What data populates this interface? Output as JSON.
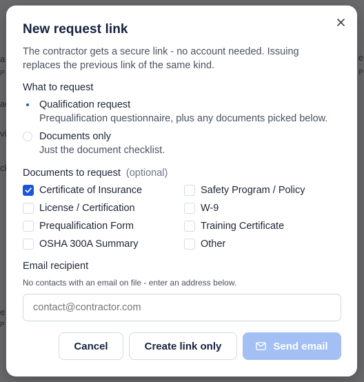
{
  "background": {
    "fragments": [
      "a",
      "P",
      "ac",
      "vi",
      "ck",
      "e",
      "P",
      "e",
      "P"
    ]
  },
  "modal": {
    "title": "New request link",
    "close_label": "×",
    "intro": "The contractor gets a secure link - no account needed. Issuing replaces the previous link of the same kind.",
    "what_to_request": {
      "label": "What to request",
      "options": [
        {
          "label": "Qualification request",
          "description": "Prequalification questionnaire, plus any documents picked below.",
          "selected": true
        },
        {
          "label": "Documents only",
          "description": "Just the document checklist.",
          "selected": false
        }
      ]
    },
    "documents": {
      "label": "Documents to request",
      "optional": "(optional)",
      "left": [
        {
          "label": "Certificate of Insurance",
          "checked": true
        },
        {
          "label": "License / Certification",
          "checked": false
        },
        {
          "label": "Prequalification Form",
          "checked": false
        },
        {
          "label": "OSHA 300A Summary",
          "checked": false
        }
      ],
      "right": [
        {
          "label": "Safety Program / Policy",
          "checked": false
        },
        {
          "label": "W-9",
          "checked": false
        },
        {
          "label": "Training Certificate",
          "checked": false
        },
        {
          "label": "Other",
          "checked": false
        }
      ]
    },
    "email": {
      "label": "Email recipient",
      "helper": "No contacts with an email on file - enter an address below.",
      "placeholder": "contact@contractor.com",
      "value": ""
    },
    "buttons": {
      "cancel": "Cancel",
      "create_link": "Create link only",
      "send_email": "Send email"
    }
  },
  "colors": {
    "accent": "#1a56db",
    "primary_disabled": "#a3bff3",
    "title": "#14213d"
  }
}
